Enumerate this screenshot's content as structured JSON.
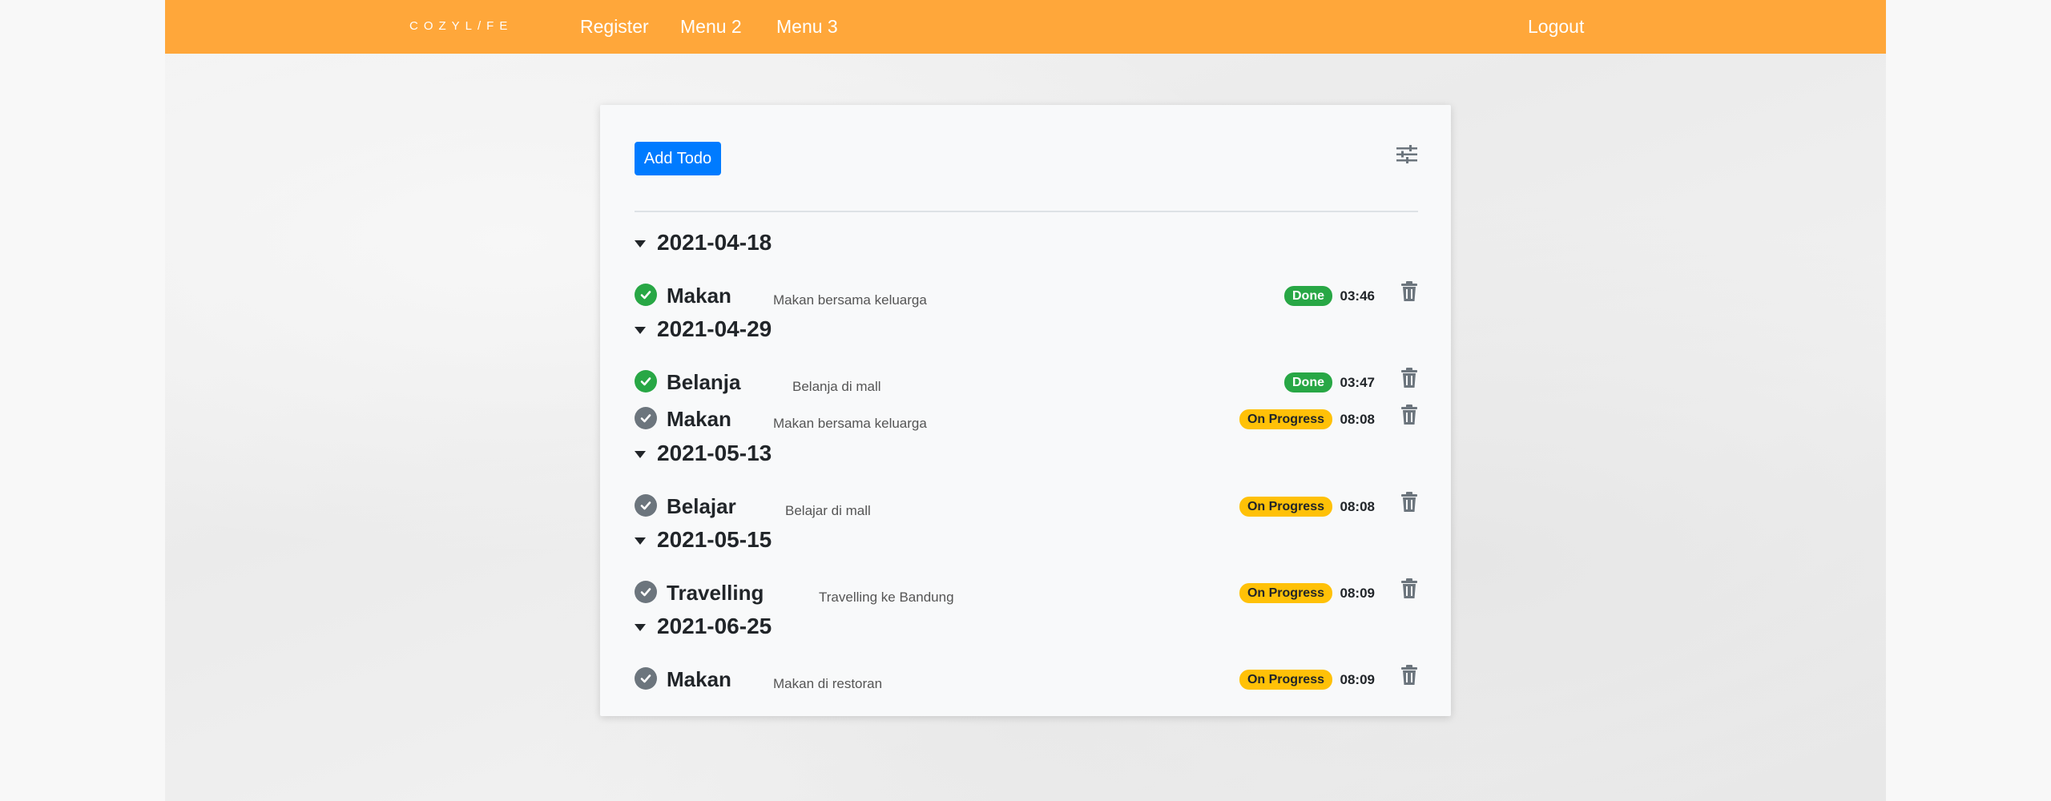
{
  "navbar": {
    "brand": "COZYL/FE",
    "links": [
      "Register",
      "Menu 2",
      "Menu 3"
    ],
    "logout": "Logout",
    "color": "#ffa73a"
  },
  "toolbar": {
    "add_label": "Add Todo",
    "filter_icon": "sliders-icon"
  },
  "groups": [
    {
      "date": "2021-04-18",
      "items": [
        {
          "title": "Makan",
          "desc": "Makan bersama keluarga",
          "status": "Done",
          "time": "03:46"
        }
      ]
    },
    {
      "date": "2021-04-29",
      "items": [
        {
          "title": "Belanja",
          "desc": "Belanja di mall",
          "status": "Done",
          "time": "03:47"
        },
        {
          "title": "Makan",
          "desc": "Makan bersama keluarga",
          "status": "On Progress",
          "time": "08:08"
        }
      ]
    },
    {
      "date": "2021-05-13",
      "items": [
        {
          "title": "Belajar",
          "desc": "Belajar di mall",
          "status": "On Progress",
          "time": "08:08"
        }
      ]
    },
    {
      "date": "2021-05-15",
      "items": [
        {
          "title": "Travelling",
          "desc": "Travelling ke Bandung",
          "status": "On Progress",
          "time": "08:09"
        }
      ]
    },
    {
      "date": "2021-06-25",
      "items": [
        {
          "title": "Makan",
          "desc": "Makan di restoran",
          "status": "On Progress",
          "time": "08:09"
        }
      ]
    }
  ],
  "colors": {
    "done": "#28a745",
    "progress": "#ffc107",
    "unchecked": "#6c757d",
    "primary": "#007bff"
  }
}
